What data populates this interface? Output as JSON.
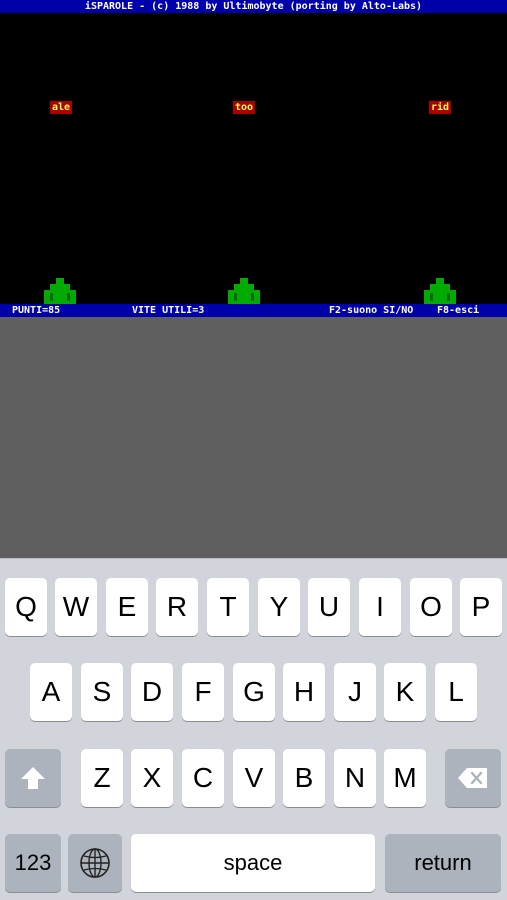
{
  "game": {
    "title": "iSPAROLE - (c) 1988 by Ultimobyte (porting by Alto-Labs)",
    "words": [
      "ale",
      "too",
      "rid"
    ],
    "status": {
      "score": "PUNTI=85",
      "lives": "VITE UTILI=3",
      "sound": "F2-suono SI/NO",
      "exit": "F8-esci"
    },
    "colors": {
      "bar": "#0000aa",
      "playfield": "#000000",
      "word_bg": "#aa0000",
      "word_text": "#ffff55",
      "cannon": "#00aa00"
    }
  },
  "keyboard": {
    "row1": [
      "Q",
      "W",
      "E",
      "R",
      "T",
      "Y",
      "U",
      "I",
      "O",
      "P"
    ],
    "row2": [
      "A",
      "S",
      "D",
      "F",
      "G",
      "H",
      "J",
      "K",
      "L"
    ],
    "row3": [
      "Z",
      "X",
      "C",
      "V",
      "B",
      "N",
      "M"
    ],
    "shift_icon": "shift-arrow-icon",
    "backspace_icon": "backspace-icon",
    "numbers_label": "123",
    "globe_icon": "globe-icon",
    "space_label": "space",
    "return_label": "return"
  }
}
